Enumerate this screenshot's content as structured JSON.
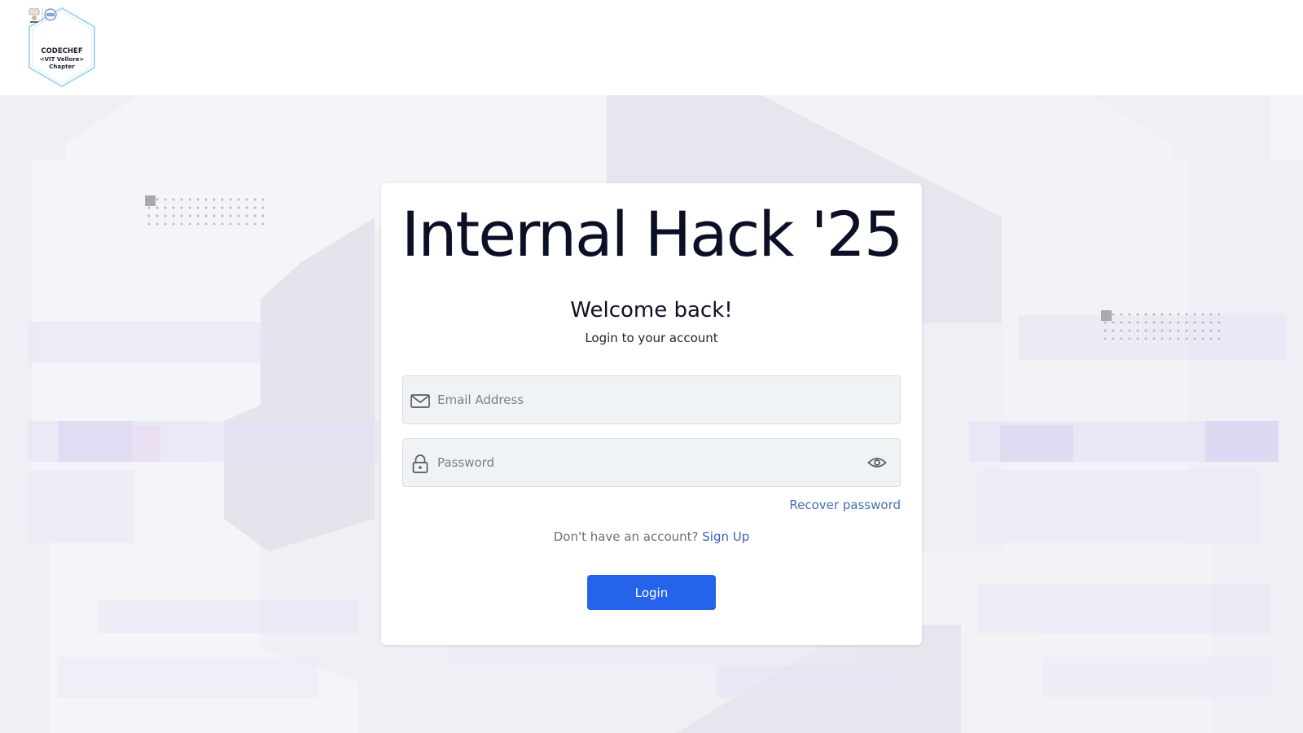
{
  "logo": {
    "line1": "CODECHEF",
    "line2": "<VIT Vellore>",
    "line3": "Chapter"
  },
  "card": {
    "title": "Internal Hack '25",
    "welcome": "Welcome back!",
    "subtitle": "Login to your account"
  },
  "form": {
    "email_placeholder": "Email Address",
    "password_placeholder": "Password",
    "recover_label": "Recover password",
    "signup_prompt": "Don't have an account?",
    "signup_link": "Sign Up",
    "login_label": "Login"
  },
  "icons": {
    "email": "mail-icon",
    "password": "lock-icon",
    "toggle": "eye-icon"
  },
  "colors": {
    "primary": "#2563eb",
    "link": "#4a6fb0",
    "title": "#0b1026",
    "background": "#eef0f5"
  }
}
